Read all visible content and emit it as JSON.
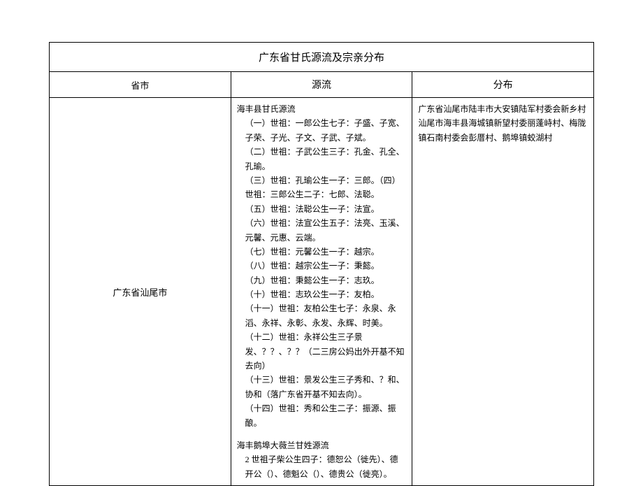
{
  "title": "广东省甘氏源流及宗亲分布",
  "headers": {
    "region": "省市",
    "origin": "源流",
    "distribution": "分布"
  },
  "row": {
    "region": "广东省汕尾市",
    "origin": {
      "section1_title": "海丰县甘氏源流",
      "lines1": [
        "（一）世祖：一郎公生七子：子盛、子宽、子荣、子光、子文、子武、子斌。",
        "（二）世祖：子武公生三子：孔金、孔全、孔瑜。",
        "（三）世祖：孔瑜公生一子：三郎。（四）世祖：三郎公生二子：七郎、法聪。",
        "（五）世祖：法聪公生一子：法宣。",
        "（六）世祖：法宣公生五子：法亮、玉溪、元馨、元惠、云端。",
        "（七）世祖：元馨公生一子：越宗。",
        "（八）世祖：越宗公生一子：秉懿。",
        "（九）世祖：秉懿公生一子：志玖。",
        "（十）世祖：志玖公生一子：友柏。",
        "（十一）世祖：友柏公生七子：永泉、永滔、永祥、永彰、永发、永辉、时美。",
        "（十二）世祖：永祥公生三子景发、？？、？？（二三房公妈出外开基不知去向）",
        "（十三）世祖：景发公生三子秀和、？和、协和（落广东省开基不知去向）。",
        "（十四）世祖：秀和公生二子：振源、振酿。"
      ],
      "section2_title": "海丰鹅埠大薇兰甘姓源流",
      "lines2": [
        "2 世祖子柴公生四子：德恕公（徙先）、德开公（）、德魁公（）、德贵公（徙亮）。"
      ]
    },
    "distribution": [
      "广东省汕尾市陆丰市大安镇陆军村委会新乡村",
      "汕尾市海丰县海城镇新望村委丽蓬峙村、梅陇镇石南村委会彭厝村、鹅埠镇蛟湖村"
    ]
  }
}
